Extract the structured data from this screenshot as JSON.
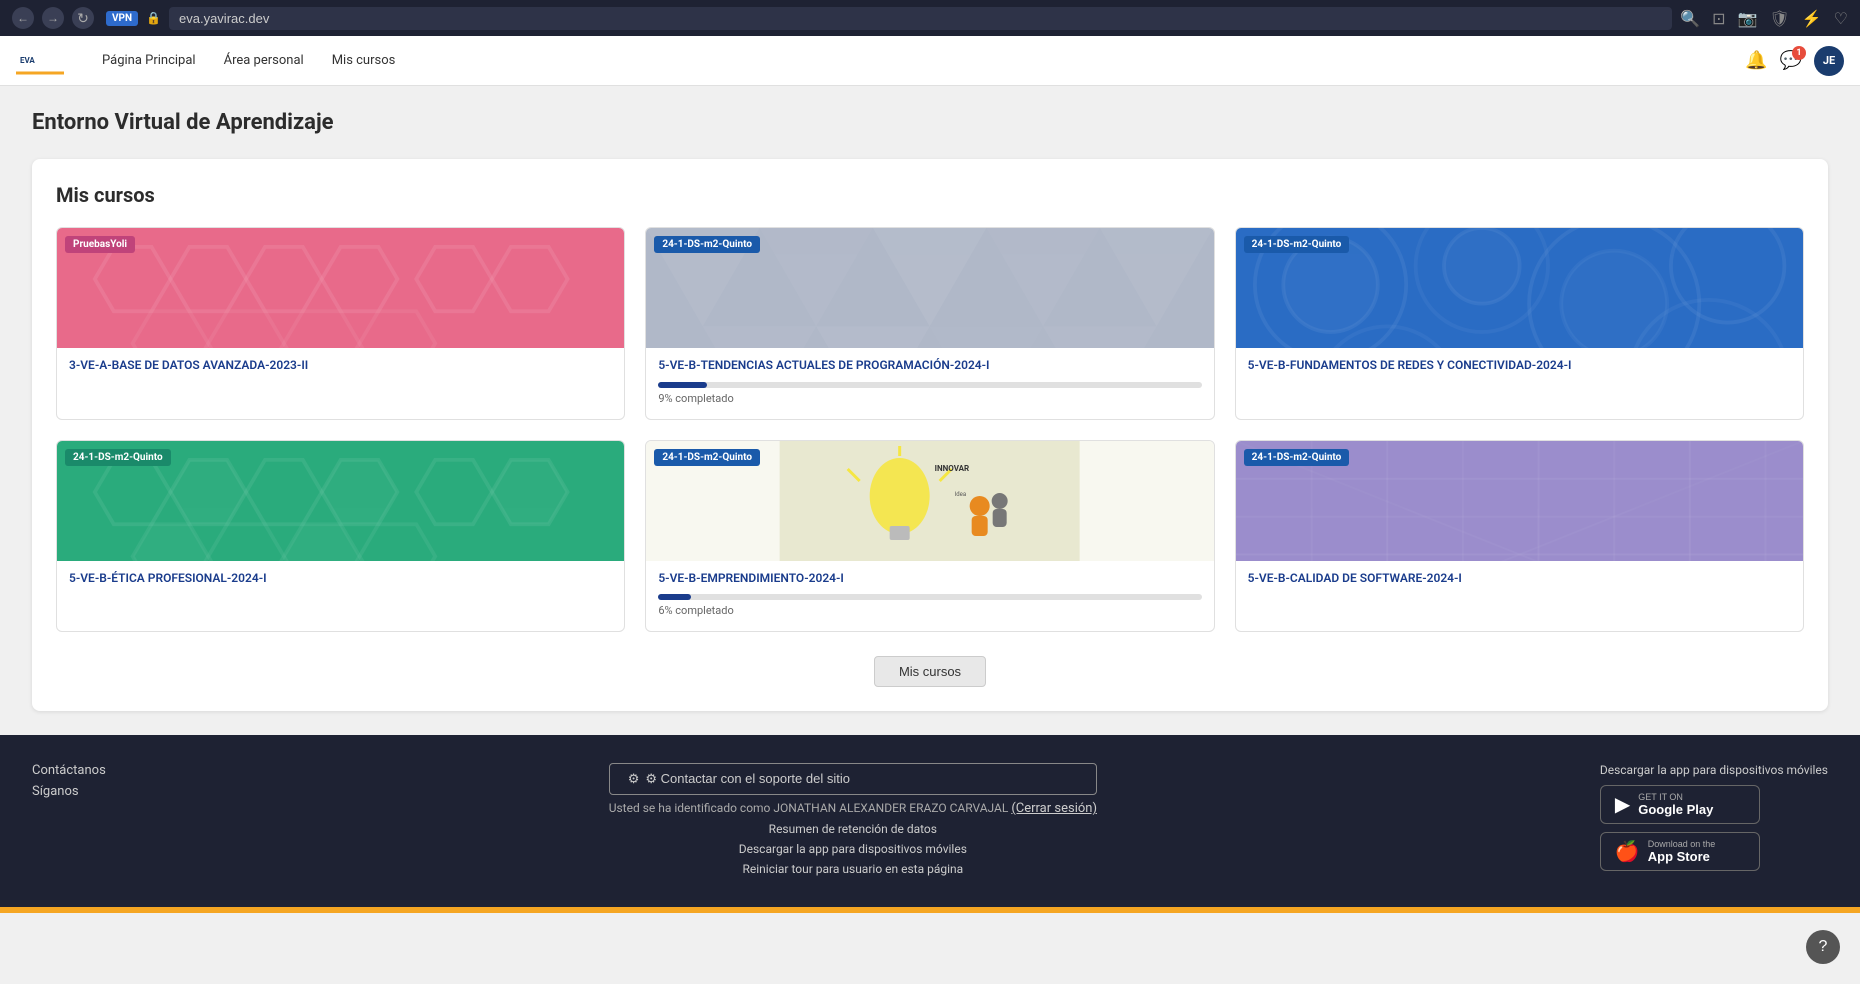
{
  "browser": {
    "url": "eva.yavirac.dev",
    "vpn_label": "VPN"
  },
  "header": {
    "nav": {
      "home": "Página Principal",
      "personal": "Área personal",
      "courses": "Mis cursos"
    },
    "avatar_label": "JE"
  },
  "page": {
    "title": "Entorno Virtual de Aprendizaje"
  },
  "courses_section": {
    "title": "Mis cursos",
    "courses": [
      {
        "tag": "PruebasYoli",
        "tag_color": "tag-pink",
        "bg_color": "bg-pink",
        "pattern": "hex",
        "name": "3-VE-A-BASE DE DATOS AVANZADA-2023-II",
        "has_progress": false
      },
      {
        "tag": "24-1-DS-m2-Quinto",
        "tag_color": "tag-blue",
        "bg_color": "bg-gray",
        "pattern": "tri",
        "name": "5-VE-B-TENDENCIAS ACTUALES DE PROGRAMACIÓN-2024-I",
        "has_progress": true,
        "progress": 9,
        "progress_text": "9% completado"
      },
      {
        "tag": "24-1-DS-m2-Quinto",
        "tag_color": "tag-blue",
        "bg_color": "bg-blue",
        "pattern": "circles",
        "name": "5-VE-B-FUNDAMENTOS DE REDES Y CONECTIVIDAD-2024-I",
        "has_progress": false
      },
      {
        "tag": "24-1-DS-m2-Quinto",
        "tag_color": "tag-teal",
        "bg_color": "bg-teal",
        "pattern": "hex",
        "name": "5-VE-B-ÉTICA PROFESIONAL-2024-I",
        "has_progress": false
      },
      {
        "tag": "24-1-DS-m2-Quinto",
        "tag_color": "tag-blue",
        "bg_color": "bg-illustration",
        "pattern": "illustration",
        "name": "5-VE-B-EMPRENDIMIENTO-2024-I",
        "has_progress": true,
        "progress": 6,
        "progress_text": "6% completado"
      },
      {
        "tag": "24-1-DS-m2-Quinto",
        "tag_color": "tag-blue",
        "bg_color": "bg-purple",
        "pattern": "grid",
        "name": "5-VE-B-CALIDAD DE SOFTWARE-2024-I",
        "has_progress": false
      }
    ],
    "more_button": "Mis cursos"
  },
  "footer": {
    "contact_link": "Contáctanos",
    "follow_link": "Síganos",
    "support_button": "⚙ Contactar con el soporte del sitio",
    "user_text": "Usted se ha identificado como JONATHAN ALEXANDER ERAZO CARVAJAL",
    "logout_link": "(Cerrar sesión)",
    "retention_link": "Resumen de retención de datos",
    "download_app_link": "Descargar la app para dispositivos móviles",
    "reiniciar_link": "Reiniciar tour para usuario en esta página",
    "app_section_title": "Descargar la app para dispositivos móviles",
    "google_play_sub": "GET IT ON",
    "google_play_name": "Google Play",
    "app_store_sub": "Download on the",
    "app_store_name": "App Store"
  }
}
